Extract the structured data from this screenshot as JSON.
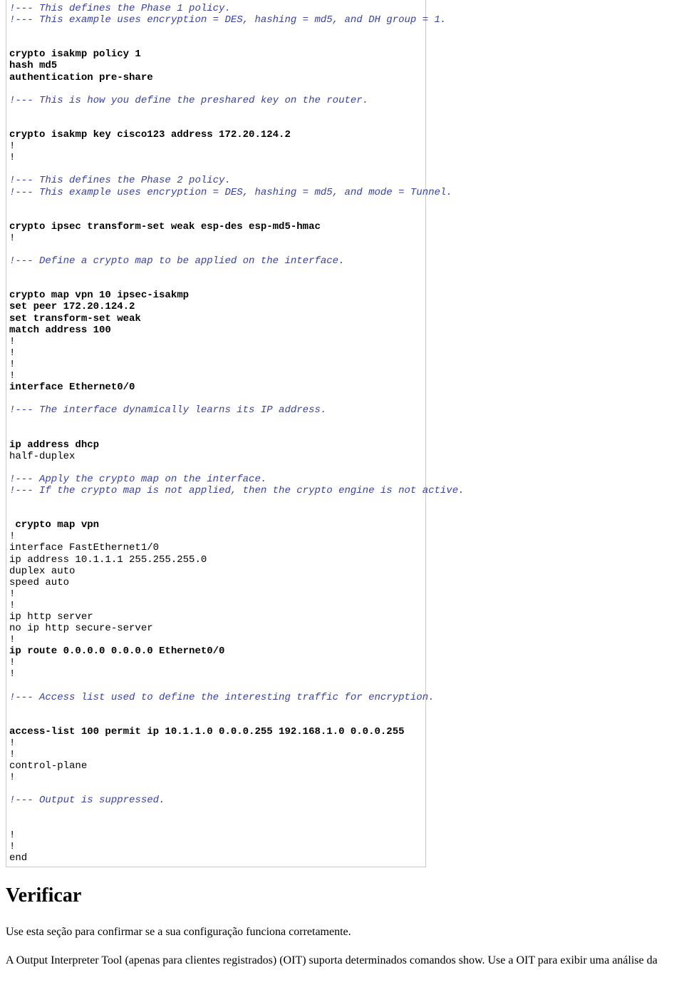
{
  "code": {
    "c_phase1_a": "!--- This defines the Phase 1 policy.",
    "c_phase1_b": "!--- This example uses encryption = DES, hashing = md5, and DH group = 1.",
    "l_policy1": "crypto isakmp policy 1",
    "l_hash": "hash md5",
    "l_auth": "authentication pre-share",
    "c_preshare": "!--- This is how you define the preshared key on the router.",
    "l_key": "crypto isakmp key cisco123 address 172.20.124.2",
    "c_phase2_a": "!--- This defines the Phase 2 policy.",
    "c_phase2_b": "!--- This example uses encryption = DES, hashing = md5, and mode = Tunnel.",
    "l_transform": "crypto ipsec transform-set weak esp-des esp-md5-hmac",
    "c_map": "!--- Define a crypto map to be applied on the interface.",
    "l_map1": "crypto map vpn 10 ipsec-isakmp",
    "l_map2": "set peer 172.20.124.2",
    "l_map3": "set transform-set weak",
    "l_map4": "match address 100",
    "l_ifeth": "interface Ethernet0/0",
    "c_dhcp": "!--- The interface dynamically learns its IP address.",
    "l_dhcp": "ip address dhcp",
    "l_halfduplex": "half-duplex",
    "c_apply_a": "!--- Apply the crypto map on the interface.",
    "c_apply_b": "!--- If the crypto map is not applied, then the crypto engine is not active.",
    "l_mapvpn": " crypto map vpn",
    "l_iffast": "interface FastEthernet1/0",
    "l_ipaddr": "ip address 10.1.1.1 255.255.255.0",
    "l_duplex": "duplex auto",
    "l_speed": "speed auto",
    "l_http": "ip http server",
    "l_nohttps": "no ip http secure-server",
    "l_route": "ip route 0.0.0.0 0.0.0.0 Ethernet0/0",
    "c_acl": "!--- Access list used to define the interesting traffic for encryption.",
    "l_acl": "access-list 100 permit ip 10.1.1.0 0.0.0.255 192.168.1.0 0.0.0.255",
    "l_ctrl": "control-plane",
    "c_suppress": "!--- Output is suppressed.",
    "l_end": "end"
  },
  "article": {
    "heading": "Verificar",
    "p1": "Use esta seção para confirmar se a sua configuração funciona corretamente.",
    "p2": "A Output Interpreter Tool (apenas para clientes registrados) (OIT) suporta determinados comandos show. Use a OIT para exibir uma análise da"
  }
}
